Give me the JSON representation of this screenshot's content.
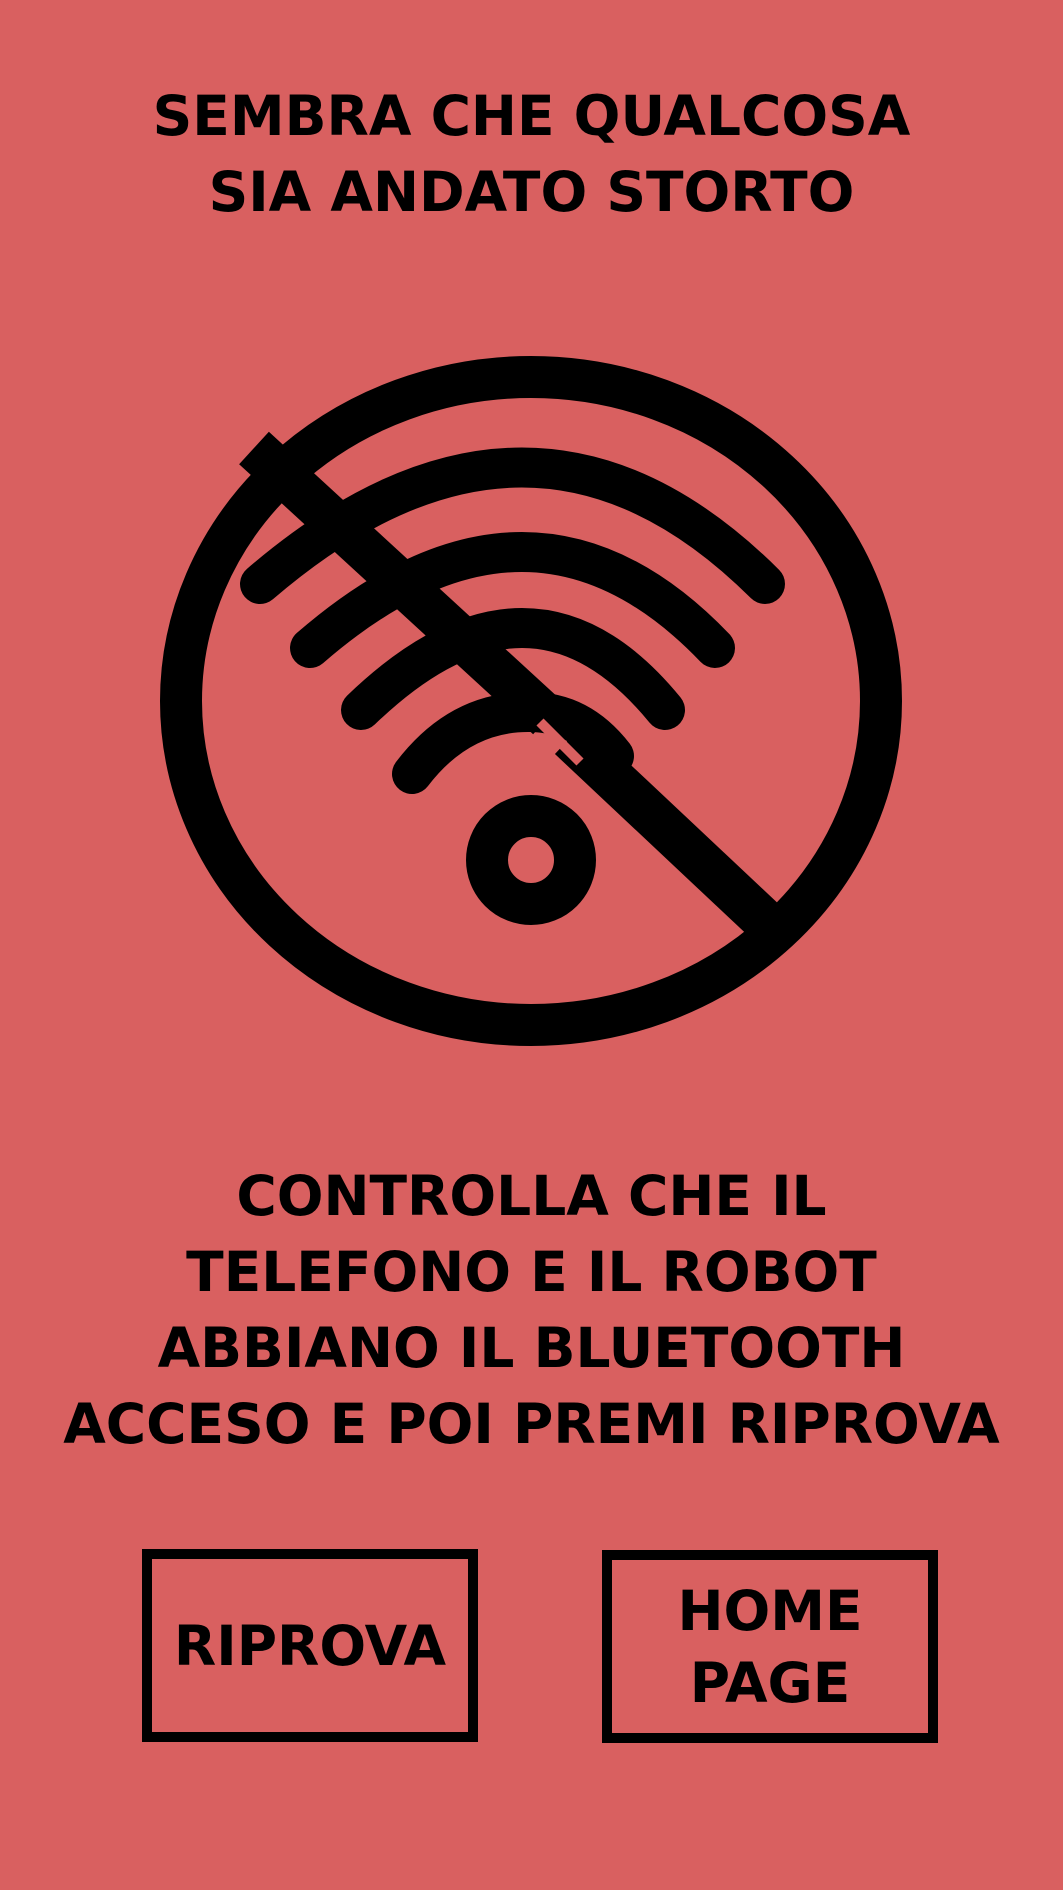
{
  "header": {
    "title_line1": "SEMBRA CHE QUALCOSA",
    "title_line2": "SIA ANDATO STORTO"
  },
  "icon": {
    "name": "wifi-off-icon",
    "color": "#000000"
  },
  "message": {
    "line1": "CONTROLLA CHE IL",
    "line2": "TELEFONO E IL ROBOT",
    "line3": "ABBIANO IL BLUETOOTH",
    "line4": "ACCESO E POI PREMI RIPROVA"
  },
  "buttons": {
    "retry_label": "RIPROVA",
    "home_label_line1": "HOME",
    "home_label_line2": "PAGE"
  },
  "colors": {
    "background": "#d96060",
    "foreground": "#000000"
  }
}
